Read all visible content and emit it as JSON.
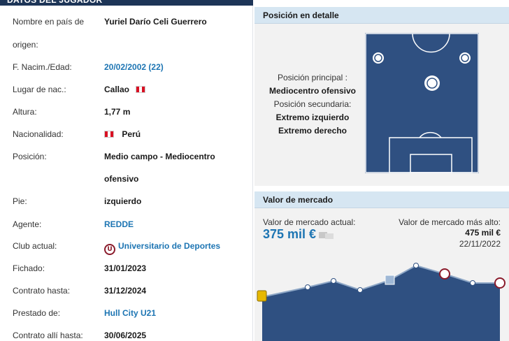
{
  "left_panel": {
    "header": "DATOS DEL JUGADOR",
    "rows": [
      {
        "label": "Nombre en país de",
        "value": "Yuriel Darío Celi Guerrero"
      },
      {
        "label": "origen:",
        "value": ""
      },
      {
        "label": "F. Nacim./Edad:",
        "value": "20/02/2002 (22)"
      },
      {
        "label": "Lugar de nac.:",
        "value": "Callao"
      },
      {
        "label": "Altura:",
        "value": "1,77 m"
      },
      {
        "label": "Nacionalidad:",
        "value": "Perú"
      },
      {
        "label": "Posición:",
        "value": "Medio campo - Mediocentro"
      },
      {
        "label": "",
        "value": "ofensivo"
      },
      {
        "label": "Pie:",
        "value": "izquierdo"
      },
      {
        "label": "Agente:",
        "value": "REDDE"
      },
      {
        "label": "Club actual:",
        "value": "Universitario de Deportes"
      },
      {
        "label": "Fichado:",
        "value": "31/01/2023"
      },
      {
        "label": "Contrato hasta:",
        "value": "31/12/2024"
      },
      {
        "label": "Prestado de:",
        "value": "Hull City U21"
      },
      {
        "label": "Contrato allí hasta:",
        "value": "30/06/2025"
      }
    ]
  },
  "position_panel": {
    "title": "Posición en detalle",
    "main_label": "Posición principal :",
    "main_value": "Mediocentro ofensivo",
    "secondary_label": "Posición secundaria:",
    "secondary_values": [
      "Extremo izquierdo",
      "Extremo derecho"
    ]
  },
  "market_panel": {
    "title": "Valor de mercado",
    "current_label": "Valor de mercado actual:",
    "current_value": "375 mil €",
    "highest_label": "Valor de mercado más alto:",
    "highest_value": "475 mil €",
    "highest_date": "22/11/2022"
  },
  "colors": {
    "header_bg": "#1d3557",
    "panel_head_bg": "#d6e6f2",
    "link": "#1d75b3",
    "pitch": "#2f5081",
    "chart_fill": "#2f5081"
  },
  "icons": {
    "peru_flag": "flag-peru-icon",
    "club_crest": "universitario-crest-icon"
  }
}
